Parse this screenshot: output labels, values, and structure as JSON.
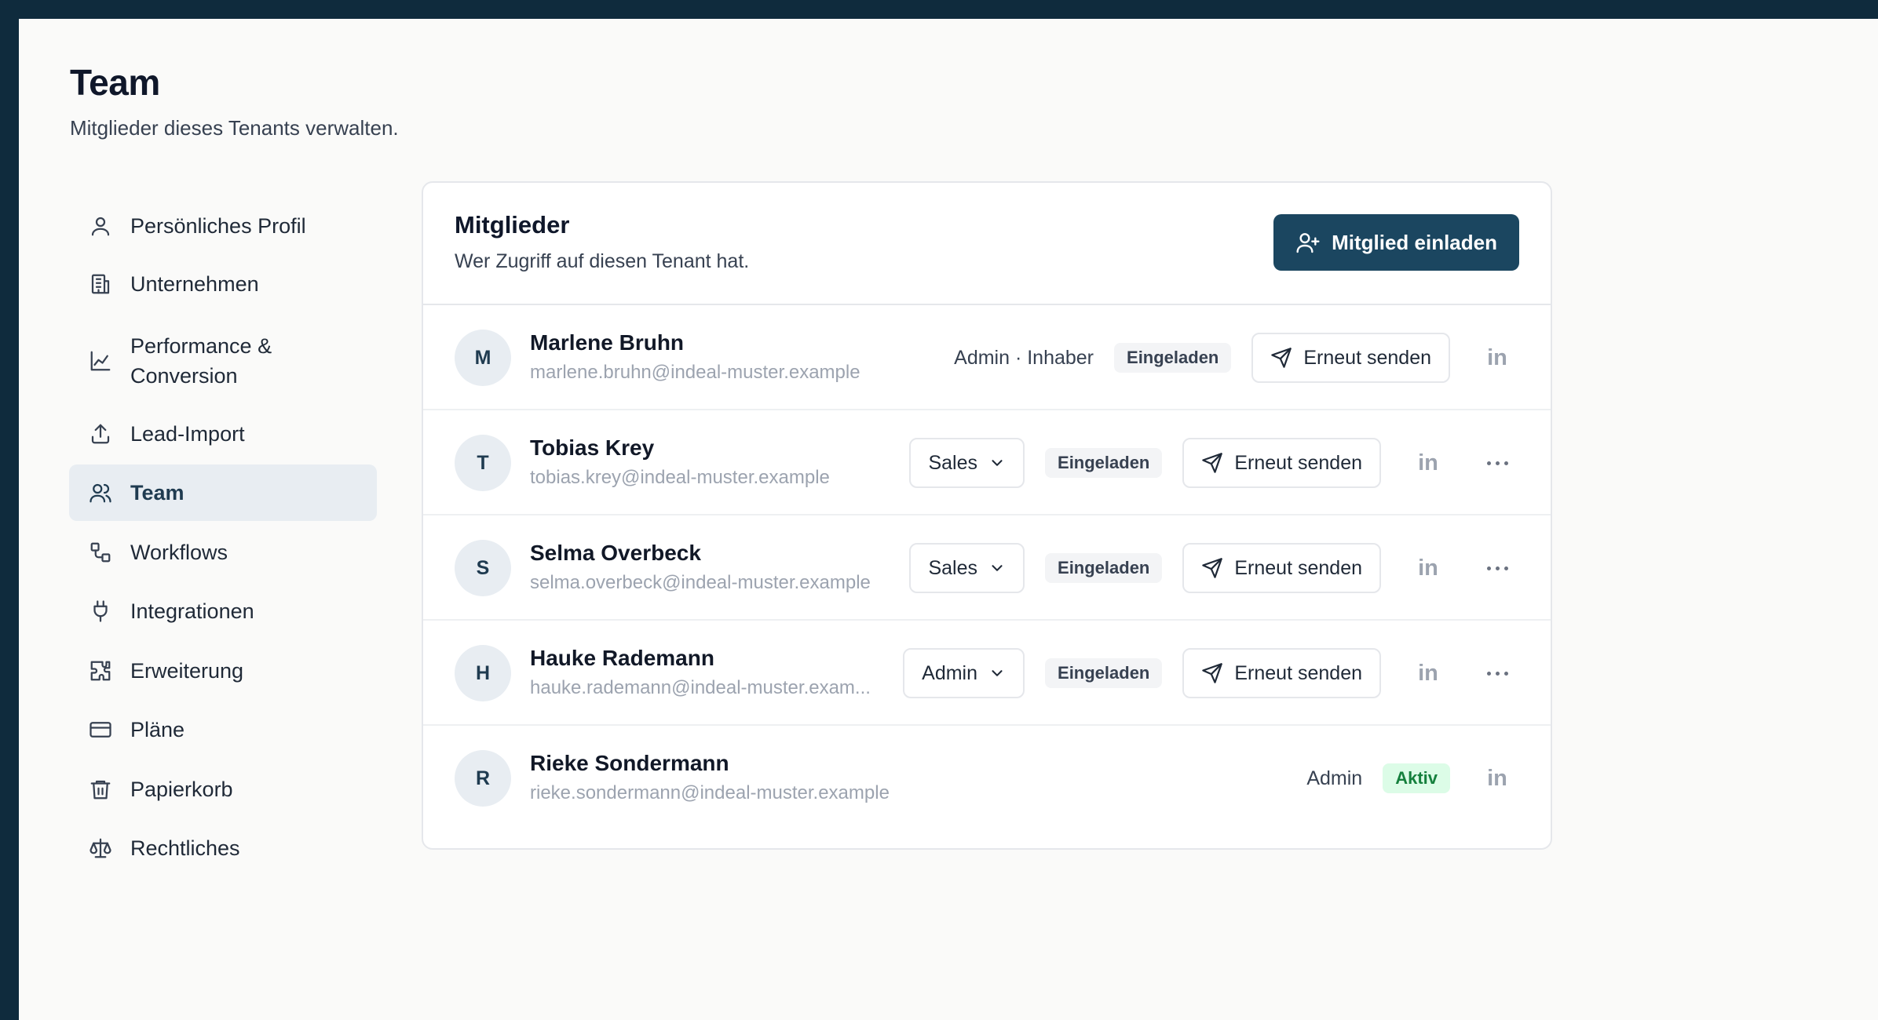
{
  "page": {
    "title": "Team",
    "subtitle": "Mitglieder dieses Tenants verwalten."
  },
  "sidebar": {
    "items": [
      {
        "label": "Persönliches Profil",
        "icon": "user-icon"
      },
      {
        "label": "Unternehmen",
        "icon": "building-icon"
      },
      {
        "label": "Performance &\nConversion",
        "icon": "chart-line-icon"
      },
      {
        "label": "Lead-Import",
        "icon": "upload-icon"
      },
      {
        "label": "Team",
        "icon": "users-icon",
        "active": true
      },
      {
        "label": "Workflows",
        "icon": "workflow-icon"
      },
      {
        "label": "Integrationen",
        "icon": "plug-icon"
      },
      {
        "label": "Erweiterung",
        "icon": "puzzle-icon"
      },
      {
        "label": "Pläne",
        "icon": "credit-card-icon"
      },
      {
        "label": "Papierkorb",
        "icon": "trash-icon"
      },
      {
        "label": "Rechtliches",
        "icon": "scale-icon"
      }
    ]
  },
  "card": {
    "title": "Mitglieder",
    "subtitle": "Wer Zugriff auf diesen Tenant hat.",
    "invite_label": "Mitglied einladen"
  },
  "members": [
    {
      "initial": "M",
      "name": "Marlene Bruhn",
      "email": "marlene.bruhn@indeal-muster.example",
      "role": "Admin · Inhaber",
      "role_editable": false,
      "status": "Eingeladen",
      "resend_label": "Erneut senden",
      "has_more": false
    },
    {
      "initial": "T",
      "name": "Tobias Krey",
      "email": "tobias.krey@indeal-muster.example",
      "role": "Sales",
      "role_editable": true,
      "status": "Eingeladen",
      "resend_label": "Erneut senden",
      "has_more": true
    },
    {
      "initial": "S",
      "name": "Selma Overbeck",
      "email": "selma.overbeck@indeal-muster.example",
      "role": "Sales",
      "role_editable": true,
      "status": "Eingeladen",
      "resend_label": "Erneut senden",
      "has_more": true
    },
    {
      "initial": "H",
      "name": "Hauke Rademann",
      "email": "hauke.rademann@indeal-muster.exam...",
      "role": "Admin",
      "role_editable": true,
      "status": "Eingeladen",
      "resend_label": "Erneut senden",
      "has_more": true
    },
    {
      "initial": "R",
      "name": "Rieke Sondermann",
      "email": "rieke.sondermann@indeal-muster.example",
      "role": "Admin",
      "role_editable": false,
      "status": "Aktiv",
      "resend_label": "",
      "has_more": false
    }
  ],
  "linkedin_label": "in",
  "colors": {
    "primary": "#1b4660",
    "frame": "#0f2b3d",
    "active_badge_bg": "#dcfce7",
    "active_badge_text": "#15803d"
  }
}
